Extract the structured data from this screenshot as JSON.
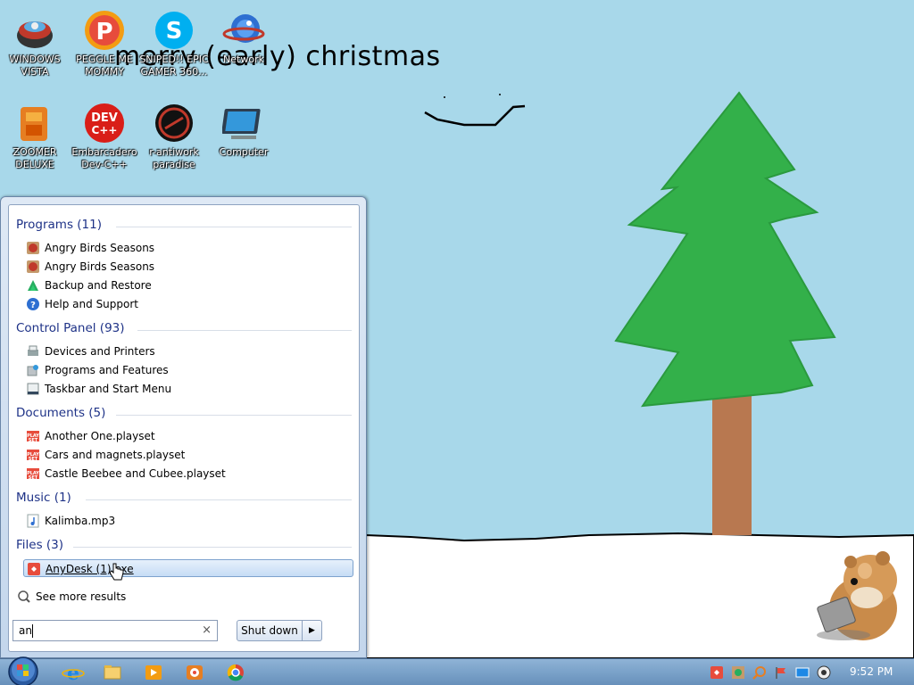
{
  "wallpaper": {
    "caption": "merry (early) christmas"
  },
  "desktop_icons": [
    {
      "label": "WINDOWS VISTA",
      "icon": "vista-icon"
    },
    {
      "label": "PEGGLE ME MOMMY",
      "icon": "peggle-icon"
    },
    {
      "label": "SNIPED!! EPIC GAMER 360...",
      "icon": "skype-icon"
    },
    {
      "label": "Network",
      "icon": "network-icon"
    },
    {
      "label": "ZOOMER DELUXE",
      "icon": "zoomer-icon"
    },
    {
      "label": "Embarcadero Dev-C++",
      "icon": "devcpp-icon"
    },
    {
      "label": "r-antiwork paradise",
      "icon": "antiwork-icon"
    },
    {
      "label": "Computer",
      "icon": "computer-icon"
    }
  ],
  "start_menu": {
    "groups": [
      {
        "header": "Programs (11)",
        "items": [
          {
            "label": "Angry Birds Seasons",
            "icon": "angry-birds-icon"
          },
          {
            "label": "Angry Birds Seasons",
            "icon": "angry-birds-icon"
          },
          {
            "label": "Backup and Restore",
            "icon": "backup-icon"
          },
          {
            "label": "Help and Support",
            "icon": "help-icon"
          }
        ]
      },
      {
        "header": "Control Panel (93)",
        "items": [
          {
            "label": "Devices and Printers",
            "icon": "printer-icon"
          },
          {
            "label": "Programs and Features",
            "icon": "programs-features-icon"
          },
          {
            "label": "Taskbar and Start Menu",
            "icon": "taskbar-icon"
          }
        ]
      },
      {
        "header": "Documents (5)",
        "items": [
          {
            "label": "Another One.playset",
            "icon": "playset-icon"
          },
          {
            "label": "Cars and magnets.playset",
            "icon": "playset-icon"
          },
          {
            "label": "Castle Beebee and Cubee.playset",
            "icon": "playset-icon"
          }
        ]
      },
      {
        "header": "Music (1)",
        "items": [
          {
            "label": "Kalimba.mp3",
            "icon": "music-file-icon"
          }
        ]
      },
      {
        "header": "Files (3)",
        "items": [
          {
            "label": "AnyDesk (1).exe",
            "icon": "anydesk-icon",
            "selected": true
          }
        ]
      }
    ],
    "see_more": "See more results",
    "search": {
      "value": "an",
      "clear_symbol": "×"
    },
    "shutdown_label": "Shut down",
    "shutdown_arrow": "▶"
  },
  "taskbar": {
    "pinned": [
      "internet-explorer-icon",
      "explorer-icon",
      "media-player-icon",
      "chrome-icon"
    ],
    "tray": [
      "anydesk-tray-icon",
      "app-tray-icon",
      "search-tray-icon",
      "flag-icon",
      "display-icon",
      "volume-icon"
    ],
    "clock": "9:52 PM"
  },
  "colors": {
    "sky": "#a8d8ea",
    "snow": "#ffffff",
    "tree": "#33b04a",
    "trunk": "#b87850",
    "group_header": "#1e3287"
  }
}
